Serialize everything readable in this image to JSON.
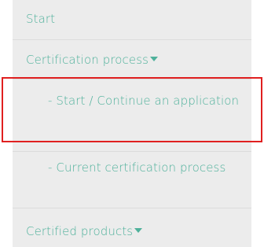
{
  "menu": {
    "items": [
      {
        "label": "Start"
      },
      {
        "label": "Certification process"
      },
      {
        "label": "- Start / Continue an application"
      },
      {
        "label": "- Current certification process"
      },
      {
        "label": "Certified products"
      }
    ]
  },
  "colors": {
    "text": "#4fb19b",
    "background": "#ececec",
    "highlight": "#e02020"
  }
}
